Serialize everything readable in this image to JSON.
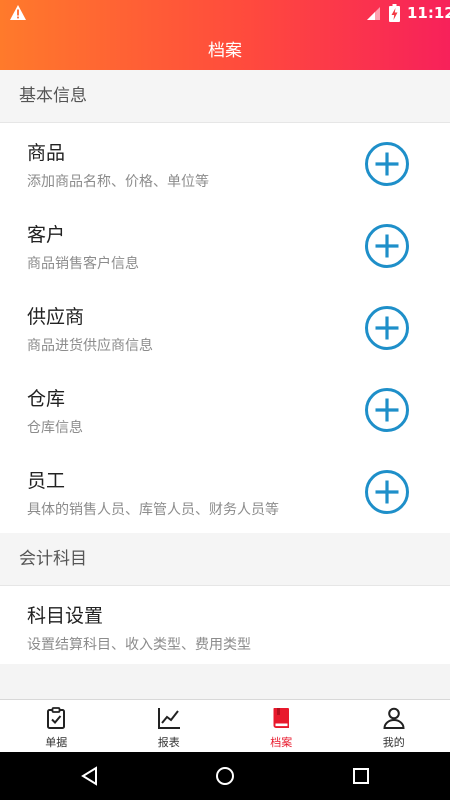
{
  "status_bar": {
    "time": "11:12"
  },
  "header": {
    "title": "档案"
  },
  "sections": [
    {
      "title": "基本信息",
      "items": [
        {
          "label": "商品",
          "desc": "添加商品名称、价格、单位等"
        },
        {
          "label": "客户",
          "desc": "商品销售客户信息"
        },
        {
          "label": "供应商",
          "desc": "商品进货供应商信息"
        },
        {
          "label": "仓库",
          "desc": "仓库信息"
        },
        {
          "label": "员工",
          "desc": "具体的销售人员、库管人员、财务人员等"
        }
      ]
    },
    {
      "title": "会计科目",
      "items": [
        {
          "label": "科目设置",
          "desc": "设置结算科目、收入类型、费用类型"
        }
      ]
    }
  ],
  "tabs": [
    {
      "label": "单据",
      "icon": "clipboard-check-icon",
      "active": false
    },
    {
      "label": "报表",
      "icon": "line-chart-icon",
      "active": false
    },
    {
      "label": "档案",
      "icon": "book-icon",
      "active": true
    },
    {
      "label": "我的",
      "icon": "person-icon",
      "active": false
    }
  ],
  "colors": {
    "accent": "#e8192c",
    "add_button": "#1e8fc9",
    "header_start": "#ff7a2b",
    "header_end": "#f7215a"
  }
}
